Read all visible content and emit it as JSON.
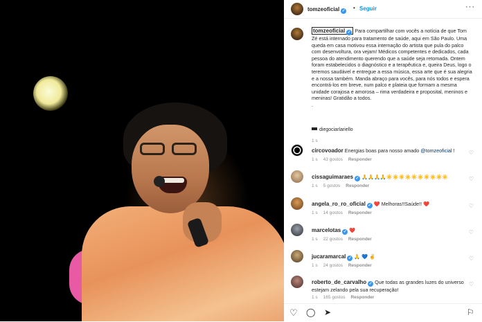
{
  "post": {
    "username": "tomzeoficial",
    "follow_label": "Seguir",
    "dot": "•",
    "more_label": "···",
    "verified_mark": "✓"
  },
  "caption": {
    "username": "tomzeoficial",
    "text": " Para compartilhar com vocês a notícia de que Tom Zé está internado para tratamento de saúde, aqui em São Paulo. Uma queda em casa motivou essa internação do artista que pula do palco com desenvoltura, ora vejam! Médicos competentes e dedicados, cada pessoa do atendimento querendo que a saúde seja retomada. Ontem foram estabelecidos o diagnóstico e a terapêutica e, queira Deus, logo o teremos saudável e entregue a essa música, essa arte que é sua alegria e a nossa também. Manda abraço para vocês, para nós todos e espera encontrá-los em breve, num palco e plateia que formam a mesma unidade corajosa e amorosa – rima verdadeira e proposital, meninos e meninas! Gratidão a todos.",
    "period": ".",
    "tag": "diegociarlariello",
    "time": "1 s"
  },
  "comments": [
    {
      "username": "circovoador",
      "verified": false,
      "text": "Energias boas para nosso amado ",
      "mention": "@tomzeoficial",
      "text_after": " !",
      "time": "1 s",
      "likes": "43 gostos",
      "reply": "Responder"
    },
    {
      "username": "cissaguimaraes",
      "verified": true,
      "text": "🙏🙏🙏🙏☀️☀️☀️☀️☀️☀️☀️☀️☀️☀️",
      "mention": "",
      "text_after": "",
      "time": "1 s",
      "likes": "5 gostos",
      "reply": "Responder"
    },
    {
      "username": "angela_ro_ro_oficial",
      "verified": true,
      "text": "❤️ Melhoras!!Saúde!! ❤️",
      "mention": "",
      "text_after": "",
      "time": "1 s",
      "likes": "14 gostos",
      "reply": "Responder"
    },
    {
      "username": "marcelotas",
      "verified": true,
      "text": "❤️",
      "mention": "",
      "text_after": "",
      "time": "1 s",
      "likes": "22 gostos",
      "reply": "Responder"
    },
    {
      "username": "jucaramarcal",
      "verified": true,
      "text": "🙏 💙 ✌️",
      "mention": "",
      "text_after": "",
      "time": "1 s",
      "likes": "24 gostos",
      "reply": "Responder"
    },
    {
      "username": "roberto_de_carvalho",
      "verified": true,
      "text": "Que todas as grandes luzes do universo estejam zelando pela sua recuperação!",
      "mention": "",
      "text_after": "",
      "time": "1 s",
      "likes": "165 gostos",
      "reply": "Responder"
    }
  ],
  "icons": {
    "like": "♡",
    "comment": "◯",
    "share": "➤",
    "save": "⚐"
  }
}
